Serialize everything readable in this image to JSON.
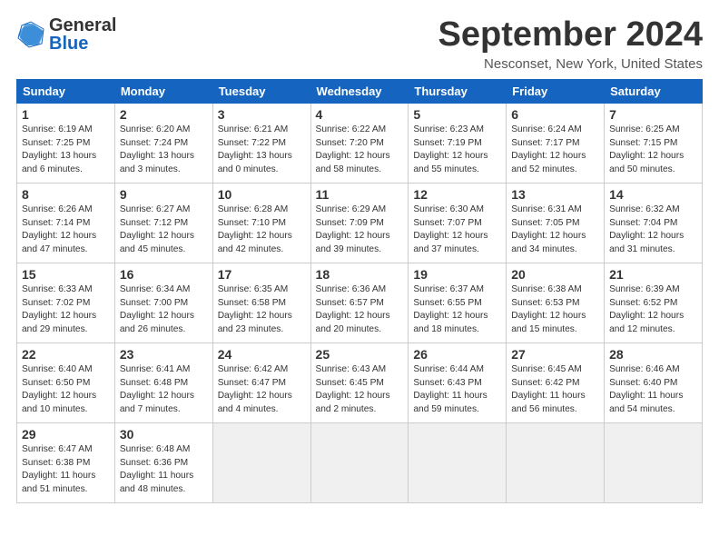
{
  "header": {
    "logo_line1": "General",
    "logo_line2": "Blue",
    "month": "September 2024",
    "location": "Nesconset, New York, United States"
  },
  "weekdays": [
    "Sunday",
    "Monday",
    "Tuesday",
    "Wednesday",
    "Thursday",
    "Friday",
    "Saturday"
  ],
  "weeks": [
    [
      {
        "day": "1",
        "info": "Sunrise: 6:19 AM\nSunset: 7:25 PM\nDaylight: 13 hours\nand 6 minutes."
      },
      {
        "day": "2",
        "info": "Sunrise: 6:20 AM\nSunset: 7:24 PM\nDaylight: 13 hours\nand 3 minutes."
      },
      {
        "day": "3",
        "info": "Sunrise: 6:21 AM\nSunset: 7:22 PM\nDaylight: 13 hours\nand 0 minutes."
      },
      {
        "day": "4",
        "info": "Sunrise: 6:22 AM\nSunset: 7:20 PM\nDaylight: 12 hours\nand 58 minutes."
      },
      {
        "day": "5",
        "info": "Sunrise: 6:23 AM\nSunset: 7:19 PM\nDaylight: 12 hours\nand 55 minutes."
      },
      {
        "day": "6",
        "info": "Sunrise: 6:24 AM\nSunset: 7:17 PM\nDaylight: 12 hours\nand 52 minutes."
      },
      {
        "day": "7",
        "info": "Sunrise: 6:25 AM\nSunset: 7:15 PM\nDaylight: 12 hours\nand 50 minutes."
      }
    ],
    [
      {
        "day": "8",
        "info": "Sunrise: 6:26 AM\nSunset: 7:14 PM\nDaylight: 12 hours\nand 47 minutes."
      },
      {
        "day": "9",
        "info": "Sunrise: 6:27 AM\nSunset: 7:12 PM\nDaylight: 12 hours\nand 45 minutes."
      },
      {
        "day": "10",
        "info": "Sunrise: 6:28 AM\nSunset: 7:10 PM\nDaylight: 12 hours\nand 42 minutes."
      },
      {
        "day": "11",
        "info": "Sunrise: 6:29 AM\nSunset: 7:09 PM\nDaylight: 12 hours\nand 39 minutes."
      },
      {
        "day": "12",
        "info": "Sunrise: 6:30 AM\nSunset: 7:07 PM\nDaylight: 12 hours\nand 37 minutes."
      },
      {
        "day": "13",
        "info": "Sunrise: 6:31 AM\nSunset: 7:05 PM\nDaylight: 12 hours\nand 34 minutes."
      },
      {
        "day": "14",
        "info": "Sunrise: 6:32 AM\nSunset: 7:04 PM\nDaylight: 12 hours\nand 31 minutes."
      }
    ],
    [
      {
        "day": "15",
        "info": "Sunrise: 6:33 AM\nSunset: 7:02 PM\nDaylight: 12 hours\nand 29 minutes."
      },
      {
        "day": "16",
        "info": "Sunrise: 6:34 AM\nSunset: 7:00 PM\nDaylight: 12 hours\nand 26 minutes."
      },
      {
        "day": "17",
        "info": "Sunrise: 6:35 AM\nSunset: 6:58 PM\nDaylight: 12 hours\nand 23 minutes."
      },
      {
        "day": "18",
        "info": "Sunrise: 6:36 AM\nSunset: 6:57 PM\nDaylight: 12 hours\nand 20 minutes."
      },
      {
        "day": "19",
        "info": "Sunrise: 6:37 AM\nSunset: 6:55 PM\nDaylight: 12 hours\nand 18 minutes."
      },
      {
        "day": "20",
        "info": "Sunrise: 6:38 AM\nSunset: 6:53 PM\nDaylight: 12 hours\nand 15 minutes."
      },
      {
        "day": "21",
        "info": "Sunrise: 6:39 AM\nSunset: 6:52 PM\nDaylight: 12 hours\nand 12 minutes."
      }
    ],
    [
      {
        "day": "22",
        "info": "Sunrise: 6:40 AM\nSunset: 6:50 PM\nDaylight: 12 hours\nand 10 minutes."
      },
      {
        "day": "23",
        "info": "Sunrise: 6:41 AM\nSunset: 6:48 PM\nDaylight: 12 hours\nand 7 minutes."
      },
      {
        "day": "24",
        "info": "Sunrise: 6:42 AM\nSunset: 6:47 PM\nDaylight: 12 hours\nand 4 minutes."
      },
      {
        "day": "25",
        "info": "Sunrise: 6:43 AM\nSunset: 6:45 PM\nDaylight: 12 hours\nand 2 minutes."
      },
      {
        "day": "26",
        "info": "Sunrise: 6:44 AM\nSunset: 6:43 PM\nDaylight: 11 hours\nand 59 minutes."
      },
      {
        "day": "27",
        "info": "Sunrise: 6:45 AM\nSunset: 6:42 PM\nDaylight: 11 hours\nand 56 minutes."
      },
      {
        "day": "28",
        "info": "Sunrise: 6:46 AM\nSunset: 6:40 PM\nDaylight: 11 hours\nand 54 minutes."
      }
    ],
    [
      {
        "day": "29",
        "info": "Sunrise: 6:47 AM\nSunset: 6:38 PM\nDaylight: 11 hours\nand 51 minutes."
      },
      {
        "day": "30",
        "info": "Sunrise: 6:48 AM\nSunset: 6:36 PM\nDaylight: 11 hours\nand 48 minutes."
      },
      {
        "day": "",
        "info": ""
      },
      {
        "day": "",
        "info": ""
      },
      {
        "day": "",
        "info": ""
      },
      {
        "day": "",
        "info": ""
      },
      {
        "day": "",
        "info": ""
      }
    ]
  ]
}
